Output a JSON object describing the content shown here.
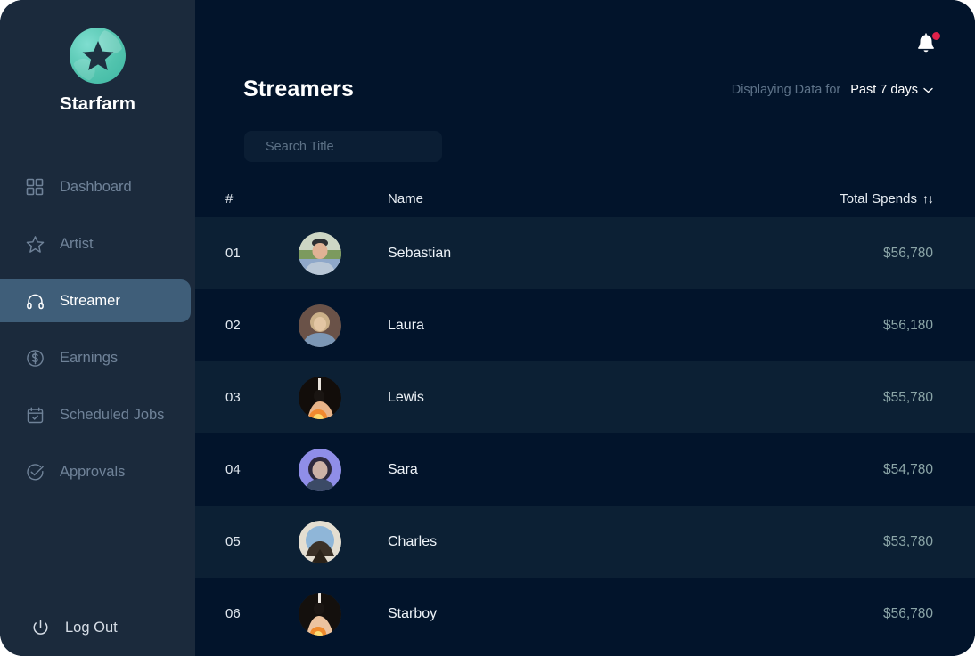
{
  "brand": {
    "name": "Starfarm",
    "logo_icon": "star-logo-icon",
    "logo_color": "#4dc0ab"
  },
  "sidebar": {
    "items": [
      {
        "label": "Dashboard",
        "icon": "grid-icon",
        "active": false
      },
      {
        "label": "Artist",
        "icon": "star-icon",
        "active": false
      },
      {
        "label": "Streamer",
        "icon": "headphones-icon",
        "active": true
      },
      {
        "label": "Earnings",
        "icon": "dollar-icon",
        "active": false
      },
      {
        "label": "Scheduled Jobs",
        "icon": "calendar-icon",
        "active": false
      },
      {
        "label": "Approvals",
        "icon": "check-circle-icon",
        "active": false
      }
    ],
    "logout": {
      "label": "Log Out",
      "icon": "power-icon"
    },
    "active_color": "#3f5e79",
    "background": "#1b2a3c"
  },
  "header": {
    "title": "Streamers",
    "notification": {
      "icon": "bell-icon",
      "has_badge": true,
      "badge_color": "#e0214a"
    },
    "range": {
      "label": "Displaying Data for",
      "selected": "Past 7 days",
      "chevron_icon": "chevron-down-icon"
    }
  },
  "search": {
    "placeholder": "Search Title",
    "value": "",
    "icon": "search-icon"
  },
  "table": {
    "columns": {
      "num": "#",
      "name": "Name",
      "spend": "Total Spends",
      "spend_sort_icon": "↑↓"
    },
    "rows": [
      {
        "num": "01",
        "name": "Sebastian",
        "spend": "$56,780",
        "avatar": "avatar-sebastian"
      },
      {
        "num": "02",
        "name": "Laura",
        "spend": "$56,180",
        "avatar": "avatar-laura"
      },
      {
        "num": "03",
        "name": "Lewis",
        "spend": "$55,780",
        "avatar": "avatar-lewis"
      },
      {
        "num": "04",
        "name": "Sara",
        "spend": "$54,780",
        "avatar": "avatar-sara"
      },
      {
        "num": "05",
        "name": "Charles",
        "spend": "$53,780",
        "avatar": "avatar-charles"
      },
      {
        "num": "06",
        "name": "Starboy",
        "spend": "$56,780",
        "avatar": "avatar-starboy"
      }
    ]
  },
  "theme": {
    "main_background": "#02142b",
    "row_alt_background": "#0c2034",
    "spend_text_color": "#8ba5a7"
  }
}
